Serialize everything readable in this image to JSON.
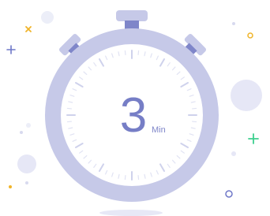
{
  "timer": {
    "value": "3",
    "unit": "Min"
  },
  "colors": {
    "ring": "#c6c9e8",
    "ring_dark": "#a4a9d9",
    "button": "#c6c9e8",
    "button_neck": "#7f86c9",
    "digit": "#767ec6",
    "unit_text": "#7f86c9",
    "tick": "#d6d8ee",
    "shadow": "#e7e8f6",
    "accent_yellow": "#f0b429",
    "accent_green": "#3ccf8e",
    "accent_blue": "#6f78c8"
  },
  "icons": [
    "stopwatch-icon",
    "plus-icon",
    "sparkle-icon",
    "circle-outline-icon",
    "dot-icon"
  ]
}
